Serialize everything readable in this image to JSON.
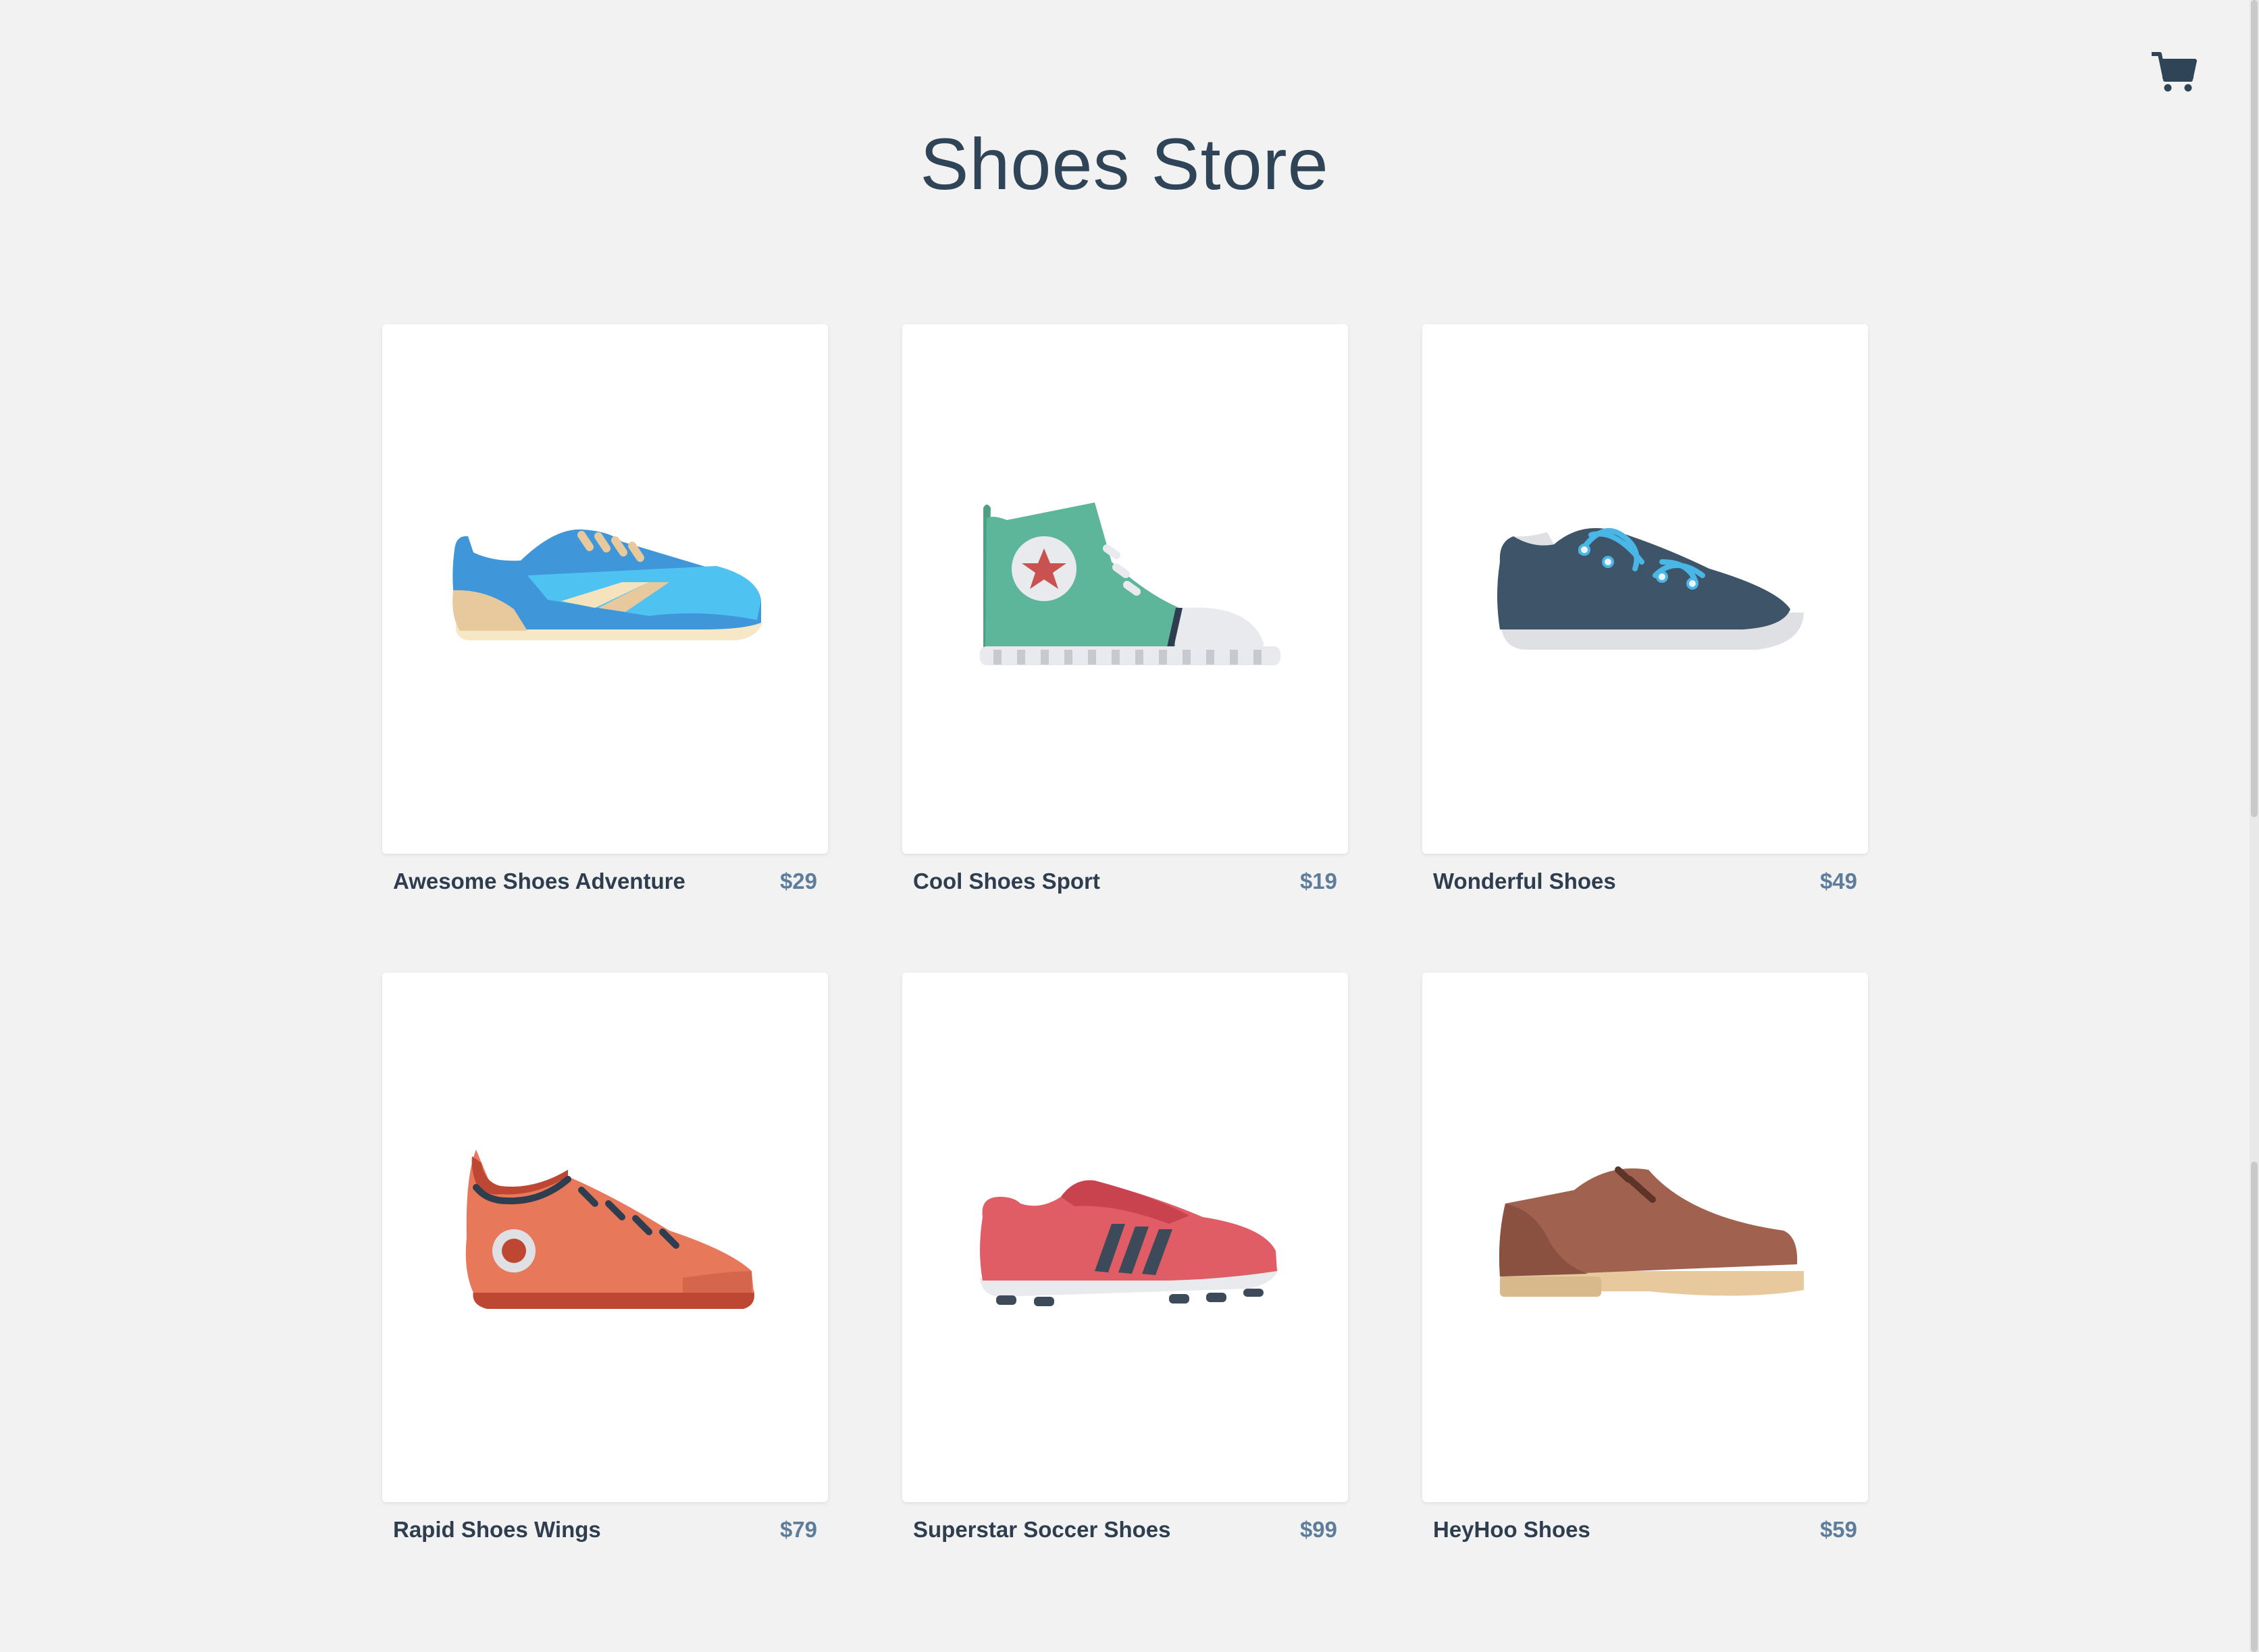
{
  "header": {
    "title": "Shoes Store",
    "cart_icon": "shopping-cart-icon"
  },
  "products": [
    {
      "name": "Awesome Shoes Adventure",
      "price": "$29",
      "icon": "blue-sneaker-icon"
    },
    {
      "name": "Cool Shoes Sport",
      "price": "$19",
      "icon": "green-hightop-icon"
    },
    {
      "name": "Wonderful Shoes",
      "price": "$49",
      "icon": "navy-sneaker-icon"
    },
    {
      "name": "Rapid Shoes Wings",
      "price": "$79",
      "icon": "orange-sneaker-icon"
    },
    {
      "name": "Superstar Soccer Shoes",
      "price": "$99",
      "icon": "red-soccer-cleat-icon"
    },
    {
      "name": "HeyHoo Shoes",
      "price": "$59",
      "icon": "brown-oxford-icon"
    }
  ],
  "colors": {
    "background": "#f2f2f2",
    "title": "#2f4457",
    "product_name": "#2f3e4f",
    "price": "#5d7d9a"
  }
}
